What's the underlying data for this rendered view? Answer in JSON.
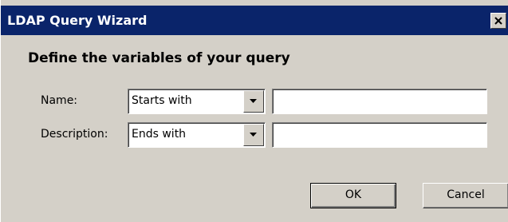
{
  "window": {
    "title": "LDAP Query Wizard",
    "close_icon": "close-icon"
  },
  "main": {
    "heading": "Define the variables of your query",
    "rows": [
      {
        "label": "Name:",
        "operator": "Starts with",
        "value": ""
      },
      {
        "label": "Description:",
        "operator": "Ends with",
        "value": ""
      }
    ]
  },
  "buttons": {
    "ok_label": "OK",
    "cancel_label": "Cancel"
  },
  "colors": {
    "titlebar": "#0a246a",
    "face": "#d4d0c8"
  }
}
